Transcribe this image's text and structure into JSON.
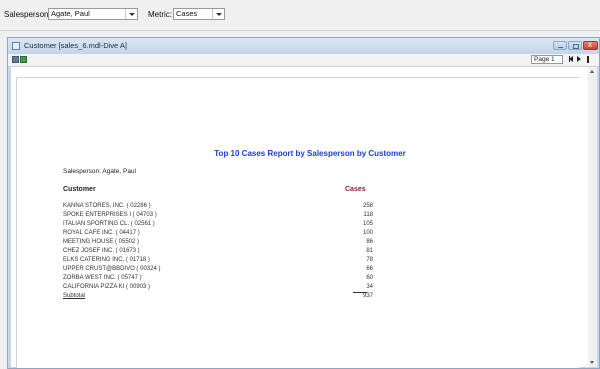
{
  "filters": {
    "salesperson_label": "Salesperson:",
    "salesperson_value": "Agate, Paul",
    "metric_label": "Metric:",
    "metric_value": "Cases"
  },
  "window": {
    "title": "Customer [sales_6.mdl-Dive A]"
  },
  "toolbar": {
    "page_value": "Page 1"
  },
  "report": {
    "title": "Top 10 Cases Report by Salesperson by Customer",
    "salesperson_line": "Salesperson: Agate, Paul",
    "header_customer": "Customer",
    "header_cases": "Cases",
    "rows": [
      {
        "name": "KANNA STORES, INC. ( 02286 )",
        "cases": "258"
      },
      {
        "name": "SPOKE ENTERPRISES I ( 04703 )",
        "cases": "118"
      },
      {
        "name": "ITALIAN SPORTING CL. ( 02561 )",
        "cases": "105"
      },
      {
        "name": "ROYAL CAFE INC. ( 04417 )",
        "cases": "100"
      },
      {
        "name": "MEETING HOUSE ( 05502 )",
        "cases": "86"
      },
      {
        "name": "CHEZ JOSEF INC. ( 01673 )",
        "cases": "81"
      },
      {
        "name": "ELKS CATERING INC. ( 01718 )",
        "cases": "78"
      },
      {
        "name": "UPPER CRUST@BBDIVO ( 00324 )",
        "cases": "66"
      },
      {
        "name": "ZORBA WEST INC. ( 05747 )",
        "cases": "60"
      },
      {
        "name": "CALIFORNIA PIZZA KI ( 00903 )",
        "cases": "34"
      }
    ],
    "subtotal_label": "Subtotal",
    "subtotal_value": "937"
  }
}
